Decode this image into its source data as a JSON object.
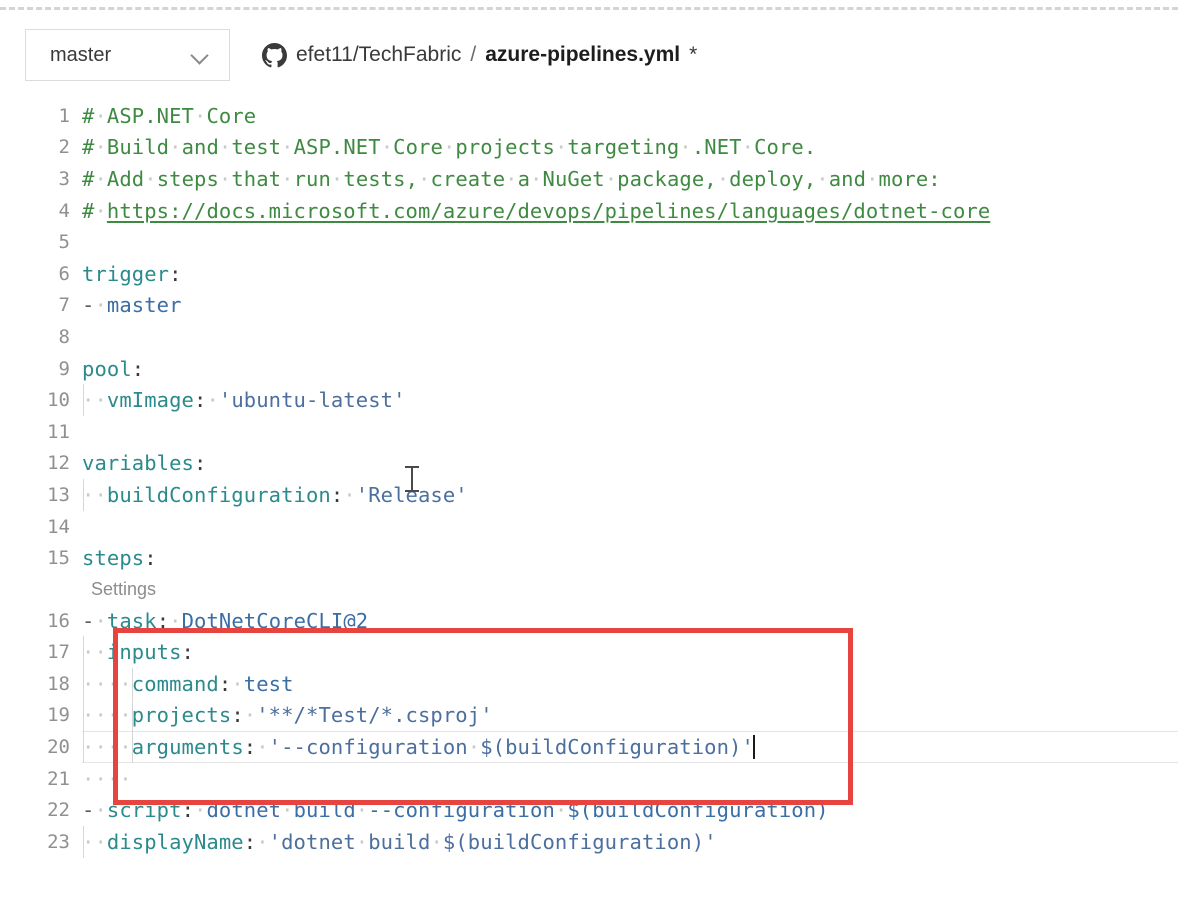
{
  "window": {
    "top_divider": "dashed-rule"
  },
  "header": {
    "branch_label": "master",
    "branch_chevron_icon": "chevron-down-icon",
    "repo_icon": "github-icon",
    "repo_path": "efet11/TechFabric",
    "separator": "/",
    "file_name": "azure-pipelines.yml",
    "dirty_marker": "*"
  },
  "editor": {
    "language": "yaml",
    "codelens": {
      "line_number": 16,
      "label": "Settings"
    },
    "cursor_line": 20,
    "mouse_cursor": "text-ibeam-cursor",
    "lines": [
      {
        "n": "1",
        "text": "# ASP.NET Core",
        "tokens": [
          {
            "t": "comment",
            "v": "#"
          },
          {
            "t": "ws",
            "v": "·"
          },
          {
            "t": "comment",
            "v": "ASP.NET"
          },
          {
            "t": "ws",
            "v": "·"
          },
          {
            "t": "comment",
            "v": "Core"
          }
        ]
      },
      {
        "n": "2",
        "text": "# Build and test ASP.NET Core projects targeting .NET Core.",
        "tokens": [
          {
            "t": "comment",
            "v": "#"
          },
          {
            "t": "ws",
            "v": "·"
          },
          {
            "t": "comment",
            "v": "Build"
          },
          {
            "t": "ws",
            "v": "·"
          },
          {
            "t": "comment",
            "v": "and"
          },
          {
            "t": "ws",
            "v": "·"
          },
          {
            "t": "comment",
            "v": "test"
          },
          {
            "t": "ws",
            "v": "·"
          },
          {
            "t": "comment",
            "v": "ASP.NET"
          },
          {
            "t": "ws",
            "v": "·"
          },
          {
            "t": "comment",
            "v": "Core"
          },
          {
            "t": "ws",
            "v": "·"
          },
          {
            "t": "comment",
            "v": "projects"
          },
          {
            "t": "ws",
            "v": "·"
          },
          {
            "t": "comment",
            "v": "targeting"
          },
          {
            "t": "ws",
            "v": "·"
          },
          {
            "t": "comment",
            "v": ".NET"
          },
          {
            "t": "ws",
            "v": "·"
          },
          {
            "t": "comment",
            "v": "Core."
          }
        ]
      },
      {
        "n": "3",
        "text": "# Add steps that run tests, create a NuGet package, deploy, and more:",
        "tokens": [
          {
            "t": "comment",
            "v": "#"
          },
          {
            "t": "ws",
            "v": "·"
          },
          {
            "t": "comment",
            "v": "Add"
          },
          {
            "t": "ws",
            "v": "·"
          },
          {
            "t": "comment",
            "v": "steps"
          },
          {
            "t": "ws",
            "v": "·"
          },
          {
            "t": "comment",
            "v": "that"
          },
          {
            "t": "ws",
            "v": "·"
          },
          {
            "t": "comment",
            "v": "run"
          },
          {
            "t": "ws",
            "v": "·"
          },
          {
            "t": "comment",
            "v": "tests,"
          },
          {
            "t": "ws",
            "v": "·"
          },
          {
            "t": "comment",
            "v": "create"
          },
          {
            "t": "ws",
            "v": "·"
          },
          {
            "t": "comment",
            "v": "a"
          },
          {
            "t": "ws",
            "v": "·"
          },
          {
            "t": "comment",
            "v": "NuGet"
          },
          {
            "t": "ws",
            "v": "·"
          },
          {
            "t": "comment",
            "v": "package,"
          },
          {
            "t": "ws",
            "v": "·"
          },
          {
            "t": "comment",
            "v": "deploy,"
          },
          {
            "t": "ws",
            "v": "·"
          },
          {
            "t": "comment",
            "v": "and"
          },
          {
            "t": "ws",
            "v": "·"
          },
          {
            "t": "comment",
            "v": "more:"
          }
        ]
      },
      {
        "n": "4",
        "text": "# https://docs.microsoft.com/azure/devops/pipelines/languages/dotnet-core",
        "tokens": [
          {
            "t": "comment",
            "v": "#"
          },
          {
            "t": "ws",
            "v": "·"
          },
          {
            "t": "comment-link",
            "v": "https://docs.microsoft.com/azure/devops/pipelines/languages/dotnet-core"
          }
        ]
      },
      {
        "n": "5",
        "text": "",
        "tokens": []
      },
      {
        "n": "6",
        "text": "trigger:",
        "tokens": [
          {
            "t": "key",
            "v": "trigger"
          },
          {
            "t": "punct",
            "v": ":"
          }
        ]
      },
      {
        "n": "7",
        "text": "- master",
        "tokens": [
          {
            "t": "dash",
            "v": "-"
          },
          {
            "t": "ws",
            "v": "·"
          },
          {
            "t": "plain",
            "v": "master"
          }
        ]
      },
      {
        "n": "8",
        "text": "",
        "tokens": []
      },
      {
        "n": "9",
        "text": "pool:",
        "tokens": [
          {
            "t": "key",
            "v": "pool"
          },
          {
            "t": "punct",
            "v": ":"
          }
        ]
      },
      {
        "n": "10",
        "text": "  vmImage: 'ubuntu-latest'",
        "guides": 1,
        "tokens": [
          {
            "t": "ws",
            "v": "··"
          },
          {
            "t": "key",
            "v": "vmImage"
          },
          {
            "t": "punct",
            "v": ":"
          },
          {
            "t": "ws",
            "v": "·"
          },
          {
            "t": "string",
            "v": "'ubuntu-latest'"
          }
        ]
      },
      {
        "n": "11",
        "text": "",
        "tokens": []
      },
      {
        "n": "12",
        "text": "variables:",
        "tokens": [
          {
            "t": "key",
            "v": "variables"
          },
          {
            "t": "punct",
            "v": ":"
          }
        ]
      },
      {
        "n": "13",
        "text": "  buildConfiguration: 'Release'",
        "guides": 1,
        "tokens": [
          {
            "t": "ws",
            "v": "··"
          },
          {
            "t": "key",
            "v": "buildConfiguration"
          },
          {
            "t": "punct",
            "v": ":"
          },
          {
            "t": "ws",
            "v": "·"
          },
          {
            "t": "string",
            "v": "'Release'"
          }
        ]
      },
      {
        "n": "14",
        "text": "",
        "tokens": []
      },
      {
        "n": "15",
        "text": "steps:",
        "tokens": [
          {
            "t": "key",
            "v": "steps"
          },
          {
            "t": "punct",
            "v": ":"
          }
        ]
      },
      {
        "n": "16",
        "text": "- task: DotNetCoreCLI@2",
        "tokens": [
          {
            "t": "dash",
            "v": "-"
          },
          {
            "t": "ws",
            "v": "·"
          },
          {
            "t": "key",
            "v": "task"
          },
          {
            "t": "punct",
            "v": ":"
          },
          {
            "t": "ws",
            "v": "·"
          },
          {
            "t": "plain",
            "v": "DotNetCoreCLI@2"
          }
        ]
      },
      {
        "n": "17",
        "text": "  inputs:",
        "guides": 1,
        "tokens": [
          {
            "t": "ws",
            "v": "··"
          },
          {
            "t": "key",
            "v": "inputs"
          },
          {
            "t": "punct",
            "v": ":"
          }
        ]
      },
      {
        "n": "18",
        "text": "    command: test",
        "guides": 2,
        "tokens": [
          {
            "t": "ws",
            "v": "··"
          },
          {
            "t": "ws",
            "v": "··"
          },
          {
            "t": "key",
            "v": "command"
          },
          {
            "t": "punct",
            "v": ":"
          },
          {
            "t": "ws",
            "v": "·"
          },
          {
            "t": "plain",
            "v": "test"
          }
        ]
      },
      {
        "n": "19",
        "text": "    projects: '**/*Test/*.csproj'",
        "guides": 2,
        "tokens": [
          {
            "t": "ws",
            "v": "··"
          },
          {
            "t": "ws",
            "v": "··"
          },
          {
            "t": "key",
            "v": "projects"
          },
          {
            "t": "punct",
            "v": ":"
          },
          {
            "t": "ws",
            "v": "·"
          },
          {
            "t": "string",
            "v": "'**/*Test/*.csproj'"
          }
        ]
      },
      {
        "n": "20",
        "text": "    arguments: '--configuration $(buildConfiguration)'",
        "guides": 2,
        "current": true,
        "tokens": [
          {
            "t": "ws",
            "v": "··"
          },
          {
            "t": "ws",
            "v": "··"
          },
          {
            "t": "key",
            "v": "arguments"
          },
          {
            "t": "punct",
            "v": ":"
          },
          {
            "t": "ws",
            "v": "·"
          },
          {
            "t": "string",
            "v": "'--configuration"
          },
          {
            "t": "ws",
            "v": "·"
          },
          {
            "t": "string",
            "v": "$(buildConfiguration)'"
          }
        ]
      },
      {
        "n": "21",
        "text": "    ",
        "tokens": [
          {
            "t": "ws",
            "v": "····"
          }
        ]
      },
      {
        "n": "22",
        "text": "- script: dotnet build --configuration $(buildConfiguration)",
        "tokens": [
          {
            "t": "dash",
            "v": "-"
          },
          {
            "t": "ws",
            "v": "·"
          },
          {
            "t": "key",
            "v": "script"
          },
          {
            "t": "punct",
            "v": ":"
          },
          {
            "t": "ws",
            "v": "·"
          },
          {
            "t": "plain",
            "v": "dotnet"
          },
          {
            "t": "ws",
            "v": "·"
          },
          {
            "t": "plain",
            "v": "build"
          },
          {
            "t": "ws",
            "v": "·"
          },
          {
            "t": "plain",
            "v": "--configuration"
          },
          {
            "t": "ws",
            "v": "·"
          },
          {
            "t": "plain",
            "v": "$(buildConfiguration)"
          }
        ]
      },
      {
        "n": "23",
        "text": "  displayName: 'dotnet build $(buildConfiguration)'",
        "guides": 1,
        "tokens": [
          {
            "t": "ws",
            "v": "··"
          },
          {
            "t": "key",
            "v": "displayName"
          },
          {
            "t": "punct",
            "v": ":"
          },
          {
            "t": "ws",
            "v": "·"
          },
          {
            "t": "string",
            "v": "'dotnet"
          },
          {
            "t": "ws",
            "v": "·"
          },
          {
            "t": "string",
            "v": "build"
          },
          {
            "t": "ws",
            "v": "·"
          },
          {
            "t": "string",
            "v": "$(buildConfiguration)'"
          }
        ]
      }
    ]
  },
  "annotation": {
    "type": "rectangle-highlight",
    "color": "#e8443f",
    "covers_lines": "16-20"
  },
  "colors": {
    "comment": "#3f8a42",
    "key": "#2b8a8c",
    "string": "#4c6f9e",
    "plain": "#3a6ea5",
    "line_number": "#909090",
    "annotation_red": "#e8443f",
    "background": "#ffffff"
  }
}
